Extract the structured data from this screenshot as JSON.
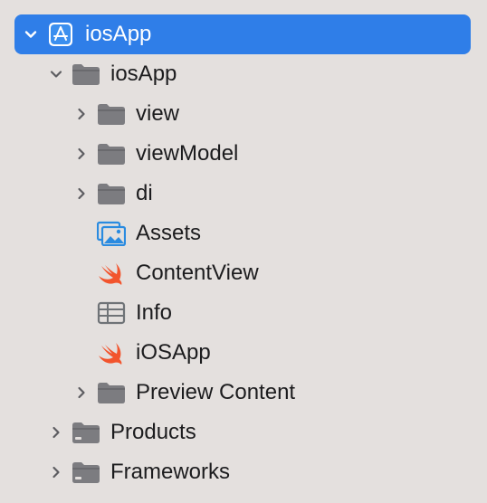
{
  "colors": {
    "background": "#e4e0de",
    "selection": "#2f7ee8",
    "folder": "#7c7c80",
    "swift": "#f2542d",
    "assets": "#2a8be0",
    "chevron": "#5d5d61"
  },
  "tree": {
    "root": {
      "label": "iosApp",
      "icon": "xcode-project-icon",
      "expanded": true,
      "selected": true
    },
    "group": {
      "label": "iosApp",
      "icon": "folder-icon",
      "expanded": true
    },
    "items": [
      {
        "label": "view",
        "icon": "folder-icon",
        "expanded": false
      },
      {
        "label": "viewModel",
        "icon": "folder-icon",
        "expanded": false
      },
      {
        "label": "di",
        "icon": "folder-icon",
        "expanded": false
      },
      {
        "label": "Assets",
        "icon": "asset-catalog-icon"
      },
      {
        "label": "ContentView",
        "icon": "swift-file-icon"
      },
      {
        "label": "Info",
        "icon": "plist-table-icon"
      },
      {
        "label": "iOSApp",
        "icon": "swift-file-icon"
      },
      {
        "label": "Preview Content",
        "icon": "folder-icon",
        "expanded": false
      }
    ],
    "bottom": [
      {
        "label": "Products",
        "icon": "folder-icon",
        "expanded": false
      },
      {
        "label": "Frameworks",
        "icon": "folder-icon",
        "expanded": false
      }
    ]
  }
}
